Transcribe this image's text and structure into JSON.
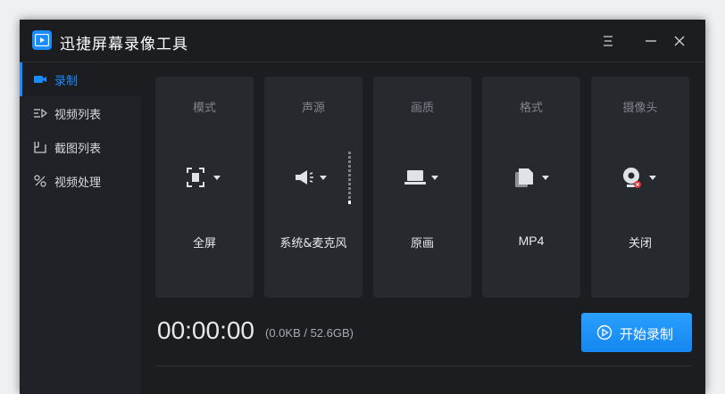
{
  "app": {
    "title": "迅捷屏幕录像工具"
  },
  "titlebar": {
    "buttons": [
      "menu-icon",
      "minimize-icon",
      "close-icon"
    ]
  },
  "sidebar": {
    "items": [
      {
        "label": "录制",
        "icon": "camera-icon",
        "active": true
      },
      {
        "label": "视频列表",
        "icon": "video-list-icon",
        "active": false
      },
      {
        "label": "截图列表",
        "icon": "screenshot-list-icon",
        "active": false
      },
      {
        "label": "视频处理",
        "icon": "video-process-icon",
        "active": false
      }
    ]
  },
  "settings": [
    {
      "title": "模式",
      "value": "全屏",
      "icon": "fullscreen-icon"
    },
    {
      "title": "声源",
      "value": "系统&麦克风",
      "icon": "speaker-icon"
    },
    {
      "title": "画质",
      "value": "原画",
      "icon": "laptop-icon"
    },
    {
      "title": "格式",
      "value": "MP4",
      "icon": "file-icon"
    },
    {
      "title": "摄像头",
      "value": "关闭",
      "icon": "webcam-icon"
    }
  ],
  "status": {
    "timer": "00:00:00",
    "size": "(0.0KB / 52.6GB)"
  },
  "actions": {
    "start_label": "开始录制"
  },
  "colors": {
    "accent": "#1a8cff",
    "background": "#1b1d21",
    "card": "#26292e",
    "sidebar": "#202227"
  }
}
